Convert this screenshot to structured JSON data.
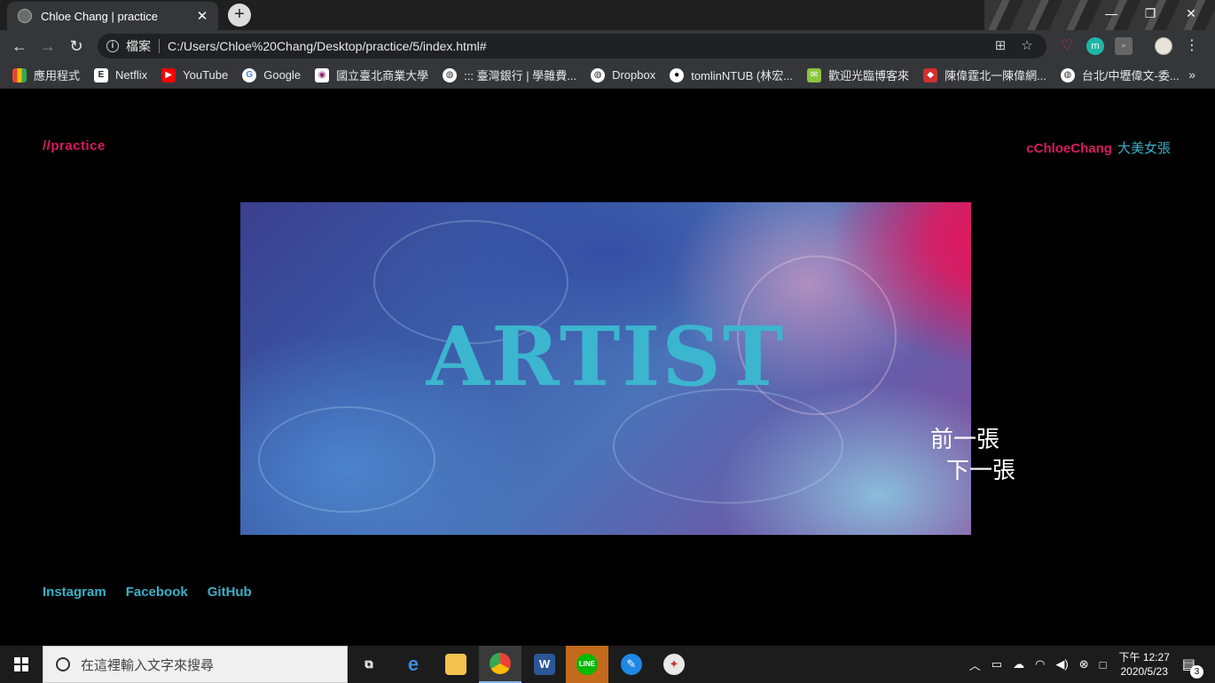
{
  "browser": {
    "tab_title": "Chloe Chang | practice",
    "tab_close": "✕",
    "new_tab": "+",
    "scheme_label": "檔案",
    "url": "C:/Users/Chloe%20Chang/Desktop/practice/5/index.html#",
    "window_controls": {
      "minimize": "—",
      "restore": "❐",
      "close": "✕"
    }
  },
  "bookmarks": [
    {
      "label": "應用程式",
      "icon": "apps-grid-icon"
    },
    {
      "label": "Netflix",
      "icon": "netflix-icon"
    },
    {
      "label": "YouTube",
      "icon": "youtube-icon"
    },
    {
      "label": "Google",
      "icon": "google-icon"
    },
    {
      "label": "國立臺北商業大學",
      "icon": "ntub-icon"
    },
    {
      "label": "::: 臺灣銀行 | 學雜費...",
      "icon": "globe-icon"
    },
    {
      "label": "Dropbox",
      "icon": "globe-icon"
    },
    {
      "label": "tomlinNTUB (林宏...",
      "icon": "github-icon"
    },
    {
      "label": "歡迎光臨博客來",
      "icon": "books-icon"
    },
    {
      "label": "陳偉霆北一陳偉網...",
      "icon": "bookmark-red-icon"
    },
    {
      "label": "台北/中壢偉文-委...",
      "icon": "globe-icon"
    }
  ],
  "bookmarks_more": "»",
  "page": {
    "brand": "//practice",
    "author_en": "cChloeChang",
    "author_zh": "大美女張",
    "hero_title": "ARTIST",
    "prev": "前一張",
    "next": "下一張",
    "social": [
      "Instagram",
      "Facebook",
      "GitHub"
    ]
  },
  "taskbar": {
    "search_placeholder": "在這裡輸入文字來搜尋",
    "time": "下午 12:27",
    "date": "2020/5/23",
    "notifications": "3"
  },
  "colors": {
    "brand_pink": "#d81b60",
    "accent_cyan": "#3ab0c8",
    "hero_title": "#3cb5cf"
  }
}
